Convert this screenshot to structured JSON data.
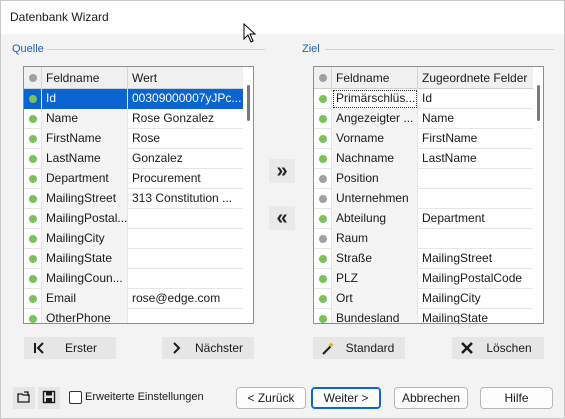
{
  "window": {
    "title": "Datenbank Wizard"
  },
  "source": {
    "group_label": "Quelle",
    "columns": [
      "Feldname",
      "Wert"
    ],
    "rows": [
      {
        "dot": "green",
        "name": "Id",
        "value": "00309000007yJPc...",
        "selected": true
      },
      {
        "dot": "green",
        "name": "Name",
        "value": "Rose Gonzalez"
      },
      {
        "dot": "green",
        "name": "FirstName",
        "value": "Rose"
      },
      {
        "dot": "green",
        "name": "LastName",
        "value": "Gonzalez"
      },
      {
        "dot": "green",
        "name": "Department",
        "value": "Procurement"
      },
      {
        "dot": "green",
        "name": "MailingStreet",
        "value": "313 Constitution ..."
      },
      {
        "dot": "green",
        "name": "MailingPostal...",
        "value": ""
      },
      {
        "dot": "green",
        "name": "MailingCity",
        "value": ""
      },
      {
        "dot": "green",
        "name": "MailingState",
        "value": ""
      },
      {
        "dot": "green",
        "name": "MailingCoun...",
        "value": ""
      },
      {
        "dot": "green",
        "name": "Email",
        "value": "rose@edge.com"
      },
      {
        "dot": "green",
        "name": "OtherPhone",
        "value": ""
      }
    ]
  },
  "target": {
    "group_label": "Ziel",
    "columns": [
      "Feldname",
      "Zugeordnete Felder"
    ],
    "rows": [
      {
        "dot": "green",
        "name": "Primärschlüs...",
        "value": "Id",
        "focused": true
      },
      {
        "dot": "green",
        "name": "Angezeigter ...",
        "value": "Name"
      },
      {
        "dot": "green",
        "name": "Vorname",
        "value": "FirstName"
      },
      {
        "dot": "green",
        "name": "Nachname",
        "value": "LastName"
      },
      {
        "dot": "gray",
        "name": "Position",
        "value": ""
      },
      {
        "dot": "gray",
        "name": "Unternehmen",
        "value": ""
      },
      {
        "dot": "green",
        "name": "Abteilung",
        "value": "Department"
      },
      {
        "dot": "gray",
        "name": "Raum",
        "value": ""
      },
      {
        "dot": "green",
        "name": "Straße",
        "value": "MailingStreet"
      },
      {
        "dot": "green",
        "name": "PLZ",
        "value": "MailingPostalCode"
      },
      {
        "dot": "green",
        "name": "Ort",
        "value": "MailingCity"
      },
      {
        "dot": "green",
        "name": "Bundesland",
        "value": "MailingState"
      }
    ]
  },
  "buttons": {
    "first": "Erster",
    "next": "Nächster",
    "standard": "Standard",
    "delete": "Löschen",
    "back": "< Zurück",
    "forward": "Weiter >",
    "cancel": "Abbrechen",
    "help": "Hilfe",
    "advanced": "Erweiterte Einstellungen"
  },
  "icons": {
    "map_right": "double-chevron-right-icon",
    "map_left": "double-chevron-left-icon",
    "first": "skip-to-start-icon",
    "next": "chevron-right-icon",
    "standard": "magic-wand-icon",
    "delete": "x-icon",
    "open": "open-folder-icon",
    "save": "floppy-disk-icon"
  },
  "colors": {
    "accent": "#0a64d2",
    "group_label": "#1e5fb4",
    "mapped_dot": "#79c35a",
    "unmapped_dot": "#a0a0a0"
  }
}
